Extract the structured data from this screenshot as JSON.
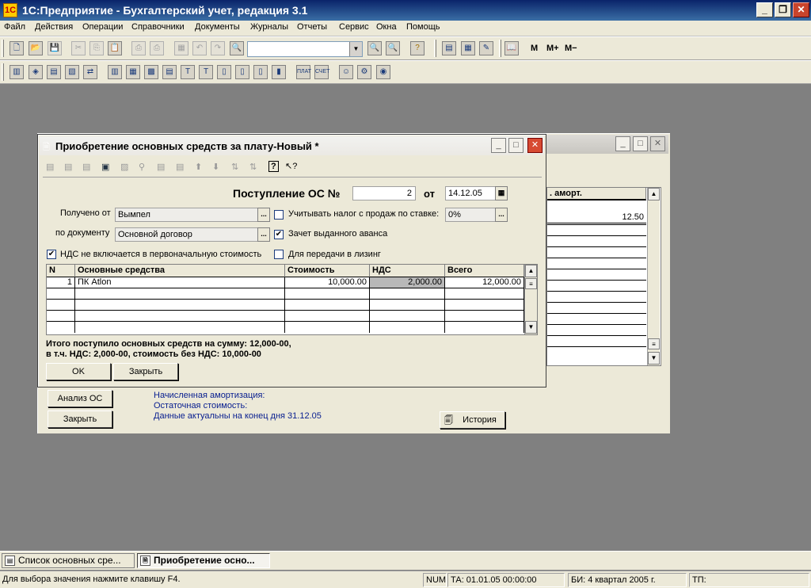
{
  "app": {
    "title": "1С:Предприятие - Бухгалтерский учет, редакция 3.1"
  },
  "menu": [
    "Файл",
    "Действия",
    "Операции",
    "Справочники",
    "Документы",
    "Журналы",
    "Отчеты",
    "Сервис",
    "Окна",
    "Помощь"
  ],
  "toolbar": {
    "search_value": "",
    "calc_buttons": {
      "m": "M",
      "mplus": "M+",
      "mminus": "M−"
    }
  },
  "bg_window": {
    "column_header": ". аморт.",
    "first_value": "12.50",
    "buttons": {
      "analysis": "Анализ ОС",
      "close": "Закрыть",
      "history": "История"
    },
    "info": {
      "line1": "Начисленная амортизация:",
      "line2": "Остаточная стоимость:",
      "line3": "Данные актуальны на конец дня 31.12.05"
    }
  },
  "dialog": {
    "title": "Приобретение основных средств за плату-Новый *",
    "doc_label": "Поступление ОС №",
    "doc_number": "2",
    "date_label": "от",
    "date_value": "14.12.05",
    "received_from_label": "Получено от",
    "received_from_value": "Вымпел",
    "by_document_label": "по документу",
    "by_document_value": "Основной договор",
    "sales_tax_label": "Учитывать налог с продаж по ставке:",
    "sales_tax_checked": false,
    "sales_tax_rate": "0%",
    "advance_label": "Зачет выданного аванса",
    "advance_checked": true,
    "vat_excluded_label": "НДС не включается в первоначальную стоимость",
    "vat_excluded_checked": true,
    "leasing_label": "Для передачи в лизинг",
    "leasing_checked": false,
    "table": {
      "headers": [
        "N",
        "Основные средства",
        "Стоимость",
        "НДС",
        "Всего"
      ],
      "rows": [
        {
          "n": "1",
          "asset": "ПК Atlon",
          "cost": "10,000.00",
          "vat": "2,000.00",
          "total": "12,000.00"
        }
      ]
    },
    "summary_line1": "Итого поступило основных средств на сумму: 12,000-00,",
    "summary_line2": "в т.ч. НДС: 2,000-00, стоимость без НДС: 10,000-00",
    "buttons": {
      "ok": "OK",
      "close": "Закрыть"
    }
  },
  "taskbar": [
    {
      "label": "Список основных сре...",
      "active": false
    },
    {
      "label": "Приобретение осно...",
      "active": true
    }
  ],
  "status": {
    "hint": "Для выбора значения нажмите клавишу F4.",
    "num": "NUM",
    "ta": "ТА: 01.01.05  00:00:00",
    "bi": "БИ: 4 квартал 2005 г.",
    "tp": "ТП:"
  }
}
